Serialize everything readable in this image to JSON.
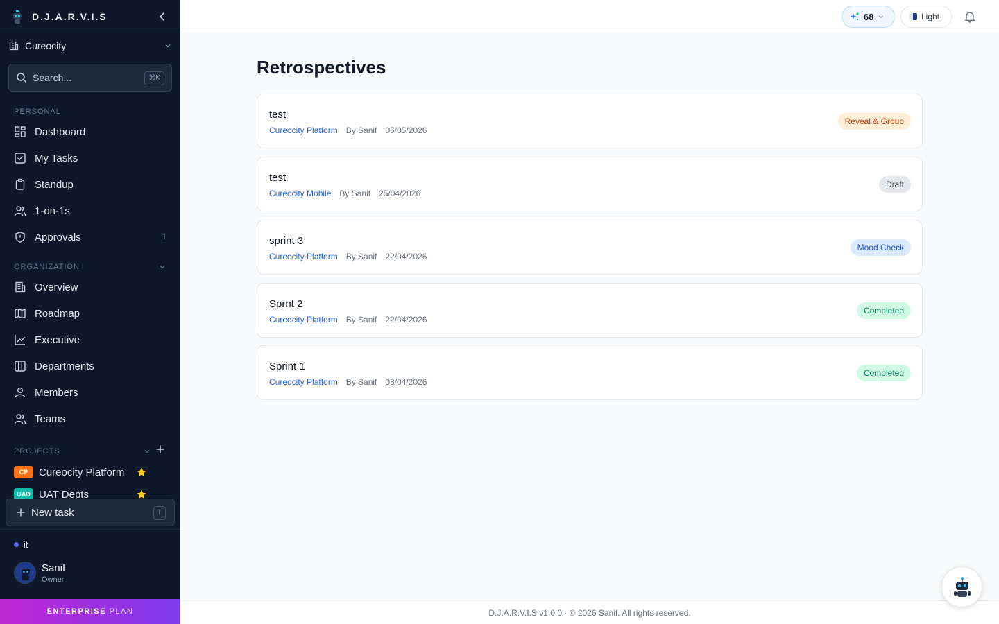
{
  "app": {
    "brand": "D.J.A.R.V.I.S"
  },
  "workspace": {
    "name": "Cureocity"
  },
  "search": {
    "placeholder": "Search...",
    "shortcut": "⌘K"
  },
  "sidebar": {
    "personal_label": "PERSONAL",
    "personal": [
      {
        "label": "Dashboard",
        "icon": "dashboard-icon"
      },
      {
        "label": "My Tasks",
        "icon": "check-square-icon"
      },
      {
        "label": "Standup",
        "icon": "clipboard-icon"
      },
      {
        "label": "1-on-1s",
        "icon": "users-icon"
      },
      {
        "label": "Approvals",
        "icon": "shield-icon",
        "count": "1"
      }
    ],
    "organization_label": "ORGANIZATION",
    "organization": [
      {
        "label": "Overview",
        "icon": "building-icon"
      },
      {
        "label": "Roadmap",
        "icon": "map-icon"
      },
      {
        "label": "Executive",
        "icon": "chart-line-icon"
      },
      {
        "label": "Departments",
        "icon": "columns-icon"
      },
      {
        "label": "Members",
        "icon": "user-icon"
      },
      {
        "label": "Teams",
        "icon": "users-icon"
      }
    ],
    "projects_label": "PROJECTS",
    "projects": [
      {
        "code": "CP",
        "name": "Cureocity Platform",
        "color": "#f97316"
      },
      {
        "code": "UAD",
        "name": "UAT Depts",
        "color": "#14b8a6"
      }
    ],
    "new_task": {
      "label": "New task",
      "shortcut": "T"
    },
    "status": "it",
    "user": {
      "name": "Sanif",
      "role": "Owner"
    },
    "plan": {
      "strong": "ENTERPRISE",
      "light": "PLAN"
    }
  },
  "topbar": {
    "points": "68",
    "theme": "Light"
  },
  "main": {
    "title": "Retrospectives",
    "retros": [
      {
        "title": "test",
        "project": "Cureocity Platform",
        "author": "By Sanif",
        "date": "05/05/2026",
        "status": "Reveal & Group"
      },
      {
        "title": "test",
        "project": "Cureocity Mobile",
        "author": "By Sanif",
        "date": "25/04/2026",
        "status": "Draft"
      },
      {
        "title": "sprint 3",
        "project": "Cureocity Platform",
        "author": "By Sanif",
        "date": "22/04/2026",
        "status": "Mood Check"
      },
      {
        "title": "Sprnt 2",
        "project": "Cureocity Platform",
        "author": "By Sanif",
        "date": "22/04/2026",
        "status": "Completed"
      },
      {
        "title": "Sprint 1",
        "project": "Cureocity Platform",
        "author": "By Sanif",
        "date": "08/04/2026",
        "status": "Completed"
      }
    ]
  },
  "footer": {
    "text": "D.J.A.R.V.I.S v1.0.0 · © 2026 Sanif. All rights reserved."
  },
  "colors": {
    "sidebar_bg": "#0f172a",
    "accent": "#2563eb",
    "plan_gradient_start": "#c026d3",
    "plan_gradient_end": "#7c3aed"
  }
}
